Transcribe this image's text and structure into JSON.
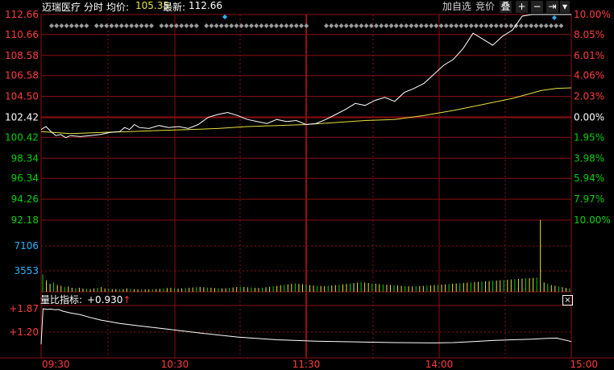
{
  "header": {
    "stock_name": "迈瑞医疗",
    "mode": "分时",
    "avg_label": "均价:",
    "avg_value": "105.35",
    "last_label": "最新:",
    "last_value": "112.66"
  },
  "toolbar": {
    "add_watch": "加自选",
    "auction": "竞价",
    "overlay": "叠",
    "plus": "+",
    "minus": "−",
    "end": "⇥",
    "dropdown": "▾"
  },
  "indicator": {
    "label": "量比指标:",
    "value": "+0.930",
    "arrow": "↑",
    "close": "×"
  },
  "colors": {
    "background": "#000000",
    "grid": "#8b1010",
    "up": "#ff3b3b",
    "down": "#00d000",
    "price_line": "#ffffff",
    "avg_line": "#e8e03c",
    "volume_axis": "#28b4ff",
    "marker": "#28b4ff"
  },
  "chart_data": {
    "type": "line",
    "prev_close": 102.42,
    "price_axis_left": [
      "112.66",
      "110.66",
      "108.58",
      "106.58",
      "104.50",
      "102.42",
      "100.42",
      "98.34",
      "96.34",
      "94.26",
      "92.18"
    ],
    "price_axis_right": [
      "10.00%",
      "8.05%",
      "6.01%",
      "4.06%",
      "2.03%",
      "0.00%",
      "1.95%",
      "3.98%",
      "5.94%",
      "7.97%",
      "10.00%"
    ],
    "ylim": [
      92.18,
      112.66
    ],
    "x_ticks": [
      "09:30",
      "10:30",
      "11:30",
      "14:00",
      "15:00"
    ],
    "price": [
      [
        0,
        101.2
      ],
      [
        5,
        101.5
      ],
      [
        10,
        101.0
      ],
      [
        15,
        100.6
      ],
      [
        20,
        100.7
      ],
      [
        25,
        100.4
      ],
      [
        30,
        100.6
      ],
      [
        40,
        100.5
      ],
      [
        50,
        100.6
      ],
      [
        60,
        100.7
      ],
      [
        70,
        100.9
      ],
      [
        80,
        101.0
      ],
      [
        85,
        101.4
      ],
      [
        90,
        101.2
      ],
      [
        95,
        101.7
      ],
      [
        100,
        101.4
      ],
      [
        110,
        101.3
      ],
      [
        120,
        101.6
      ],
      [
        130,
        101.4
      ],
      [
        140,
        101.5
      ],
      [
        150,
        101.3
      ],
      [
        160,
        101.7
      ],
      [
        170,
        102.4
      ],
      [
        180,
        102.7
      ],
      [
        190,
        102.9
      ],
      [
        200,
        102.6
      ],
      [
        210,
        102.2
      ],
      [
        220,
        102.0
      ],
      [
        230,
        101.8
      ],
      [
        240,
        102.2
      ],
      [
        250,
        102.0
      ],
      [
        260,
        102.1
      ],
      [
        270,
        101.7
      ],
      [
        280,
        101.8
      ],
      [
        290,
        102.2
      ],
      [
        300,
        102.7
      ],
      [
        310,
        103.2
      ],
      [
        320,
        103.8
      ],
      [
        330,
        103.6
      ],
      [
        340,
        104.1
      ],
      [
        350,
        104.4
      ],
      [
        360,
        104.0
      ],
      [
        370,
        104.9
      ],
      [
        380,
        105.3
      ],
      [
        390,
        105.8
      ],
      [
        400,
        106.7
      ],
      [
        410,
        107.6
      ],
      [
        420,
        108.2
      ],
      [
        430,
        109.3
      ],
      [
        440,
        110.8
      ],
      [
        450,
        110.2
      ],
      [
        460,
        109.6
      ],
      [
        470,
        110.5
      ],
      [
        480,
        111.1
      ],
      [
        490,
        112.5
      ],
      [
        500,
        112.66
      ],
      [
        510,
        112.66
      ],
      [
        520,
        112.66
      ],
      [
        530,
        112.66
      ],
      [
        540,
        112.66
      ]
    ],
    "avg": [
      [
        0,
        101.0
      ],
      [
        30,
        100.8
      ],
      [
        60,
        100.9
      ],
      [
        90,
        101.0
      ],
      [
        120,
        101.1
      ],
      [
        150,
        101.2
      ],
      [
        180,
        101.3
      ],
      [
        210,
        101.5
      ],
      [
        240,
        101.6
      ],
      [
        270,
        101.7
      ],
      [
        300,
        101.9
      ],
      [
        330,
        102.1
      ],
      [
        360,
        102.2
      ],
      [
        390,
        102.6
      ],
      [
        420,
        103.1
      ],
      [
        450,
        103.7
      ],
      [
        480,
        104.3
      ],
      [
        510,
        105.1
      ],
      [
        525,
        105.3
      ],
      [
        540,
        105.35
      ]
    ],
    "volume_axis": [
      "7106",
      "3553"
    ],
    "volume_max": 10659,
    "volume": [
      2600,
      1700,
      1200,
      1400,
      1000,
      900,
      700,
      800,
      600,
      500,
      600,
      500,
      450,
      400,
      500,
      600,
      700,
      500,
      450,
      400,
      420,
      380,
      400,
      500,
      450,
      400,
      380,
      350,
      360,
      380,
      400,
      420,
      450,
      500,
      560,
      600,
      540,
      480,
      520,
      560,
      600,
      650,
      700,
      720,
      680,
      640,
      600,
      560,
      520,
      500,
      540,
      580,
      640,
      700,
      760,
      720,
      680,
      640,
      600,
      580,
      620,
      680,
      740,
      820,
      900,
      980,
      1060,
      1120,
      1180,
      1240,
      1180,
      1120,
      1060,
      1000,
      940,
      900,
      880,
      860,
      900,
      940,
      1000,
      1060,
      1120,
      1180,
      1240,
      1300,
      1360,
      1420,
      1380,
      1320,
      1260,
      1200,
      1140,
      1100,
      1060,
      1020,
      980,
      940,
      900,
      860,
      820,
      800,
      820,
      840,
      880,
      920,
      960,
      1000,
      1040,
      1080,
      1120,
      1160,
      1200,
      1240,
      1280,
      1320,
      1360,
      1400,
      1440,
      1480,
      1520,
      1560,
      1600,
      1640,
      1680,
      1720,
      1760,
      1800,
      1840,
      1880,
      1920,
      1960,
      2000,
      2040,
      2080,
      2120,
      10659,
      1400,
      1200,
      1000,
      900,
      800,
      700,
      600,
      500
    ],
    "indicator_axis": [
      "+1.87",
      "+1.20"
    ],
    "volume_ratio": [
      [
        0,
        0.85
      ],
      [
        2,
        1.87
      ],
      [
        6,
        1.85
      ],
      [
        10,
        1.86
      ],
      [
        14,
        1.84
      ],
      [
        18,
        1.85
      ],
      [
        22,
        1.8
      ],
      [
        30,
        1.75
      ],
      [
        40,
        1.7
      ],
      [
        50,
        1.62
      ],
      [
        60,
        1.55
      ],
      [
        80,
        1.45
      ],
      [
        100,
        1.38
      ],
      [
        130,
        1.28
      ],
      [
        160,
        1.18
      ],
      [
        200,
        1.06
      ],
      [
        240,
        0.98
      ],
      [
        280,
        0.94
      ],
      [
        320,
        0.92
      ],
      [
        360,
        0.9
      ],
      [
        400,
        0.89
      ],
      [
        420,
        0.9
      ],
      [
        440,
        0.93
      ],
      [
        460,
        0.96
      ],
      [
        480,
        0.98
      ],
      [
        500,
        1.0
      ],
      [
        515,
        1.02
      ],
      [
        525,
        1.03
      ],
      [
        540,
        0.93
      ]
    ]
  }
}
